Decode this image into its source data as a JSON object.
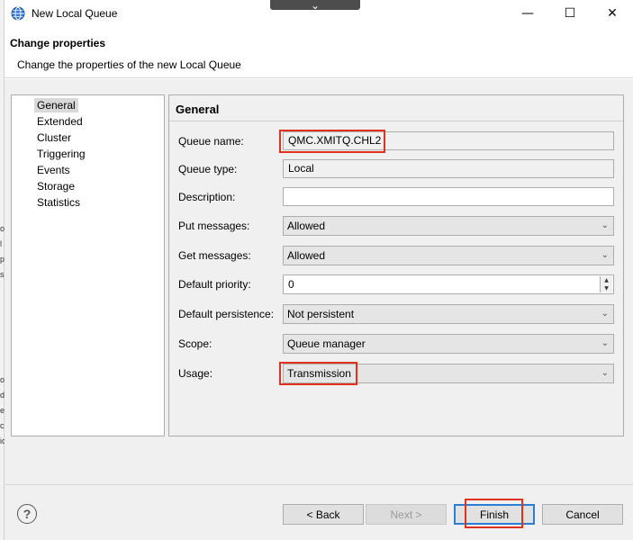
{
  "window": {
    "title": "New Local Queue",
    "minimize": "—",
    "maximize": "☐",
    "close": "✕",
    "dropper": "⌄"
  },
  "header": {
    "title": "Change properties",
    "description": "Change the properties of the new Local Queue"
  },
  "left_strip_chars": [
    "o",
    "l",
    "p",
    "s",
    "o",
    "d",
    "e",
    "ci",
    "ic",
    "o",
    "l",
    "c",
    "s"
  ],
  "nav": {
    "items": [
      "General",
      "Extended",
      "Cluster",
      "Triggering",
      "Events",
      "Storage",
      "Statistics"
    ],
    "selected": "General"
  },
  "section": {
    "title": "General"
  },
  "fields": {
    "queue_name": {
      "label": "Queue name:",
      "value": "QMC.XMITQ.CHL2"
    },
    "queue_type": {
      "label": "Queue type:",
      "value": "Local"
    },
    "description": {
      "label": "Description:",
      "value": ""
    },
    "put_messages": {
      "label": "Put messages:",
      "value": "Allowed"
    },
    "get_messages": {
      "label": "Get messages:",
      "value": "Allowed"
    },
    "default_priority": {
      "label": "Default priority:",
      "value": "0"
    },
    "default_persistence": {
      "label": "Default persistence:",
      "value": "Not persistent"
    },
    "scope": {
      "label": "Scope:",
      "value": "Queue manager"
    },
    "usage": {
      "label": "Usage:",
      "value": "Transmission"
    }
  },
  "buttons": {
    "help": "?",
    "back": "< Back",
    "next": "Next >",
    "finish": "Finish",
    "cancel": "Cancel"
  },
  "icons": {
    "chevron": "⌄",
    "spin_up": "▲",
    "spin_down": "▼"
  },
  "colors": {
    "highlight": "#e0321f",
    "default_button_border": "#2a7fd4"
  }
}
